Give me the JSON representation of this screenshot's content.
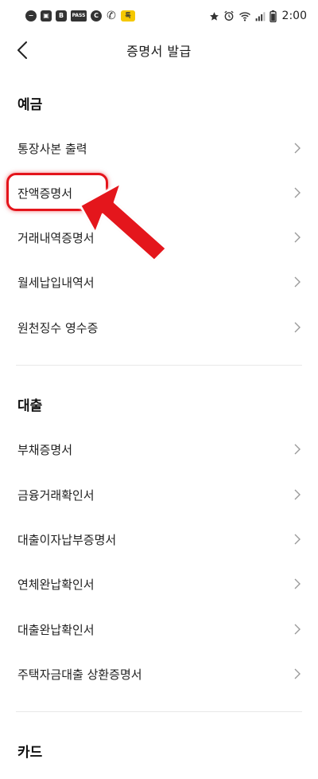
{
  "status_bar": {
    "time": "2:00",
    "left_icons": [
      "minus-circle-icon",
      "gallery-icon",
      "b-app-icon",
      "pass-app-icon",
      "c-app-icon",
      "phone-miss-icon",
      "kakao-icon"
    ],
    "left_labels": [
      "−",
      "▣",
      "B",
      "PASS",
      "C",
      "✆",
      "톡"
    ],
    "right_icons": [
      "star-icon",
      "alarm-icon",
      "wifi-icon",
      "signal-icon",
      "battery-icon"
    ]
  },
  "header": {
    "title": "증명서 발급",
    "back_icon": "chevron-left-icon"
  },
  "sections": {
    "deposit": {
      "title": "예금",
      "items": [
        "통장사본 출력",
        "잔액증명서",
        "거래내역증명서",
        "월세납입내역서",
        "원천징수 영수증"
      ]
    },
    "loan": {
      "title": "대출",
      "items": [
        "부채증명서",
        "금융거래확인서",
        "대출이자납부증명서",
        "연체완납확인서",
        "대출완납확인서",
        "주택자금대출 상환증명서"
      ]
    },
    "card": {
      "title": "카드"
    }
  },
  "annotation": {
    "highlight_color": "#e4141b",
    "highlighted_item": "잔액증명서",
    "arrow_icon": "red-arrow-icon"
  },
  "colors": {
    "text": "#1f1f1f",
    "divider": "#e8e8e8",
    "chevron": "#9a9a9a",
    "accent_red": "#e4141b"
  }
}
